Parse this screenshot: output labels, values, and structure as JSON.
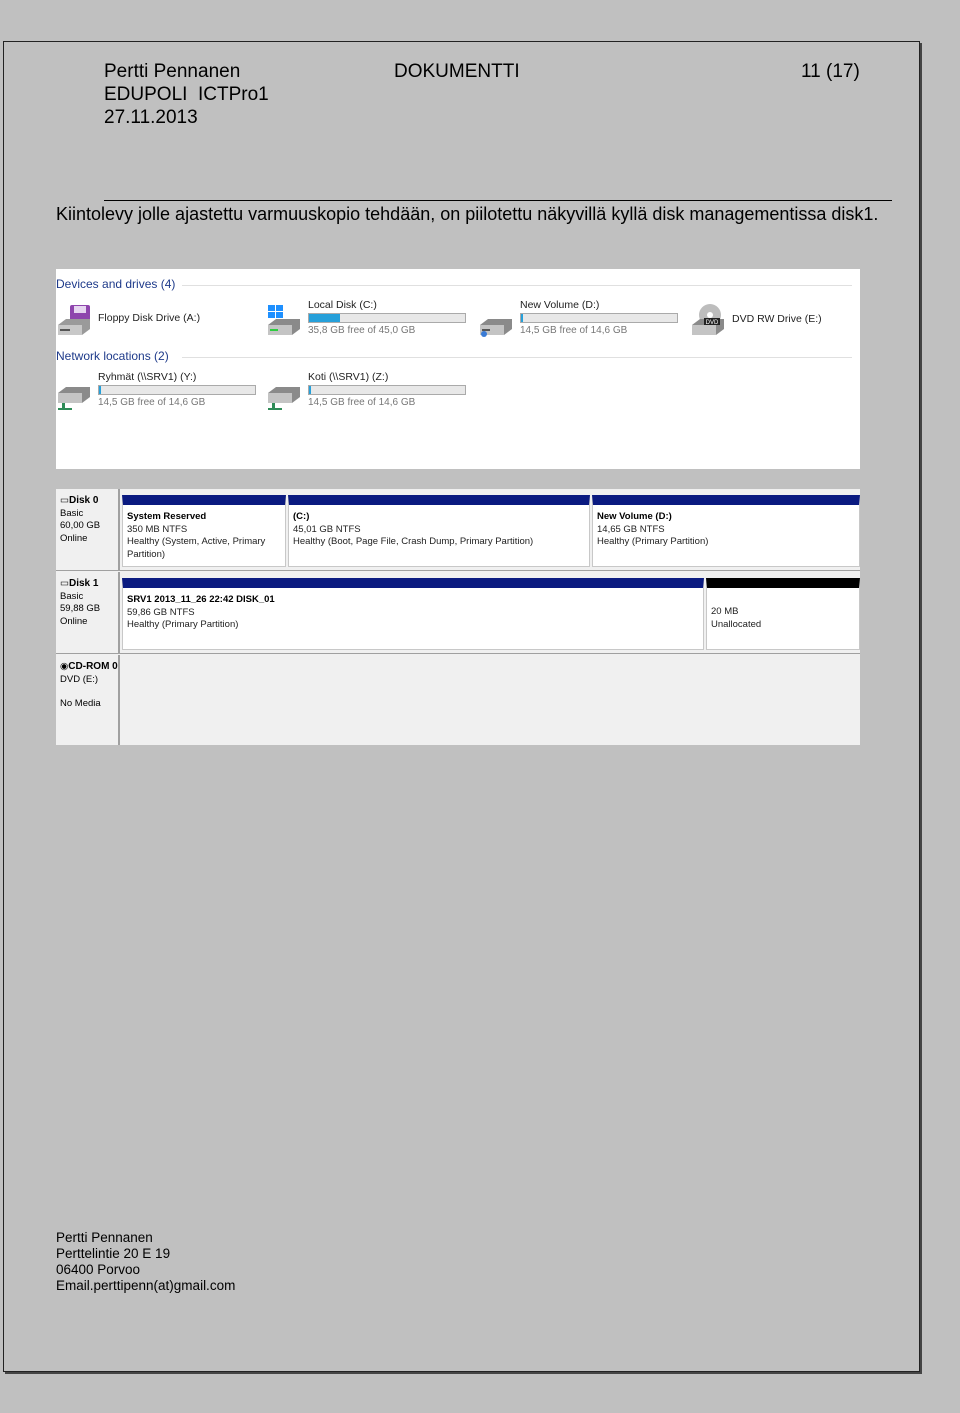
{
  "header": {
    "author": "Pertti Pennanen",
    "org": "EDUPOLI  ICTPro1",
    "date": "27.11.2013",
    "doc_type": "DOKUMENTTI",
    "page": "11 (17)"
  },
  "body": {
    "paragraph": "Kiintolevy jolle ajastettu varmuuskopio tehdään, on piilotettu näkyvillä kyllä disk managementissa disk1."
  },
  "explorer": {
    "devices_heading": "Devices and drives (4)",
    "network_heading": "Network locations (2)",
    "drives": [
      {
        "name": "Floppy Disk Drive (A:)",
        "free": "",
        "icon": "floppy-icon"
      },
      {
        "name": "Local Disk (C:)",
        "free": "35,8 GB free of 45,0 GB",
        "fill": 0.2,
        "icon": "windows-drive-icon"
      },
      {
        "name": "New Volume (D:)",
        "free": "14,5 GB free of 14,6 GB",
        "fill": 0.01,
        "icon": "drive-icon"
      },
      {
        "name": "DVD RW Drive (E:)",
        "free": "",
        "icon": "dvd-icon",
        "badge": "DVD"
      }
    ],
    "network": [
      {
        "name": "Ryhmät (\\\\SRV1) (Y:)",
        "free": "14,5 GB free of 14,6 GB",
        "fill": 0.01,
        "icon": "network-drive-icon"
      },
      {
        "name": "Koti (\\\\SRV1) (Z:)",
        "free": "14,5 GB free of 14,6 GB",
        "fill": 0.01,
        "icon": "network-drive-icon"
      }
    ],
    "bar_color": "#26a0da"
  },
  "disk_mgmt": {
    "disks": [
      {
        "name": "Disk 0",
        "type": "Basic",
        "size": "60,00 GB",
        "status": "Online",
        "partitions": [
          {
            "title": "System Reserved",
            "size": "350 MB NTFS",
            "status": "Healthy (System, Active, Primary Partition)"
          },
          {
            "title": "(C:)",
            "size": "45,01 GB NTFS",
            "status": "Healthy (Boot, Page File, Crash Dump, Primary Partition)"
          },
          {
            "title": "New Volume  (D:)",
            "size": "14,65 GB NTFS",
            "status": "Healthy (Primary Partition)"
          }
        ]
      },
      {
        "name": "Disk 1",
        "type": "Basic",
        "size": "59,88 GB",
        "status": "Online",
        "partitions": [
          {
            "title": "SRV1 2013_11_26 22:42 DISK_01",
            "size": "59,86 GB NTFS",
            "status": "Healthy (Primary Partition)"
          },
          {
            "title": "",
            "size": "20 MB",
            "status": "Unallocated"
          }
        ]
      },
      {
        "name": "CD-ROM 0",
        "type": "DVD (E:)",
        "size": "",
        "status": "No Media",
        "partitions": []
      }
    ],
    "primary_color": "#0a1a80",
    "unallocated_color": "#000000"
  },
  "footer": {
    "name": "Pertti Pennanen",
    "street": "Perttelintie 20 E 19",
    "city": "06400 Porvoo",
    "email": "Email.perttipenn(at)gmail.com"
  }
}
